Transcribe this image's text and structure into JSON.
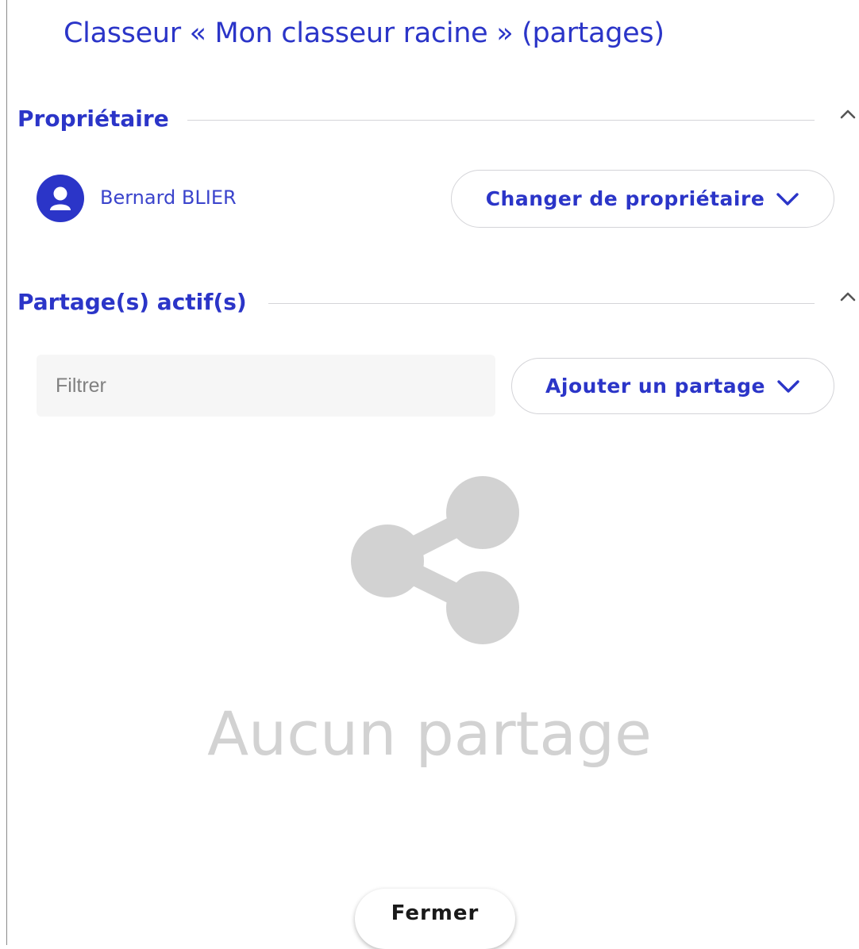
{
  "dialog": {
    "title": "Classeur « Mon classeur racine » (partages)"
  },
  "owner_section": {
    "title": "Propriétaire",
    "owner_name": "Bernard BLIER",
    "change_owner_label": "Changer de propriétaire"
  },
  "shares_section": {
    "title": "Partage(s) actif(s)",
    "filter_placeholder": "Filtrer",
    "filter_value": "",
    "add_share_label": "Ajouter un partage",
    "empty_message": "Aucun partage"
  },
  "footer": {
    "close_label": "Fermer"
  },
  "colors": {
    "accent": "#2b35c8",
    "muted": "#d2d2d2"
  },
  "icons": [
    "chevron-up-icon",
    "user-icon",
    "chevron-down-icon",
    "share-icon"
  ]
}
